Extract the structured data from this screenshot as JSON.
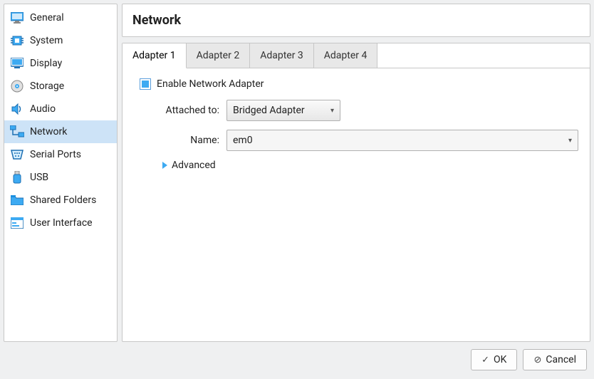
{
  "sidebar": {
    "items": [
      {
        "label": "General"
      },
      {
        "label": "System"
      },
      {
        "label": "Display"
      },
      {
        "label": "Storage"
      },
      {
        "label": "Audio"
      },
      {
        "label": "Network"
      },
      {
        "label": "Serial Ports"
      },
      {
        "label": "USB"
      },
      {
        "label": "Shared Folders"
      },
      {
        "label": "User Interface"
      }
    ],
    "selected_index": 5
  },
  "page": {
    "title": "Network",
    "tabs": [
      {
        "label": "Adapter 1"
      },
      {
        "label": "Adapter 2"
      },
      {
        "label": "Adapter 3"
      },
      {
        "label": "Adapter 4"
      }
    ],
    "active_tab": 0,
    "enable_label": "Enable Network Adapter",
    "enable_checked": true,
    "attached_label": "Attached to:",
    "attached_value": "Bridged Adapter",
    "name_label": "Name:",
    "name_value": "em0",
    "advanced_label": "Advanced"
  },
  "buttons": {
    "ok": "OK",
    "cancel": "Cancel"
  }
}
